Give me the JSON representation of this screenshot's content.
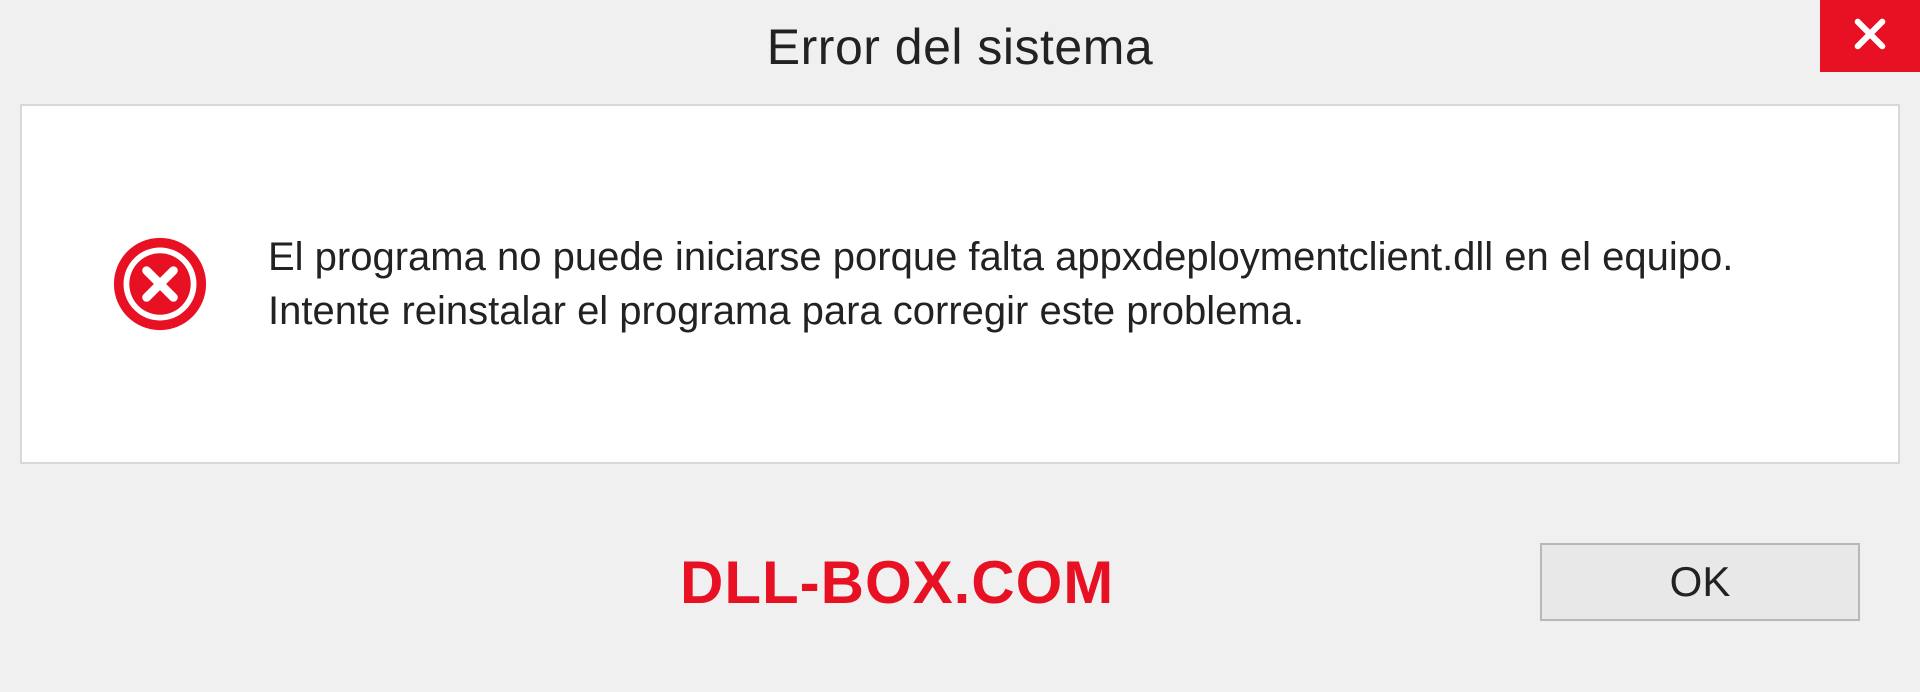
{
  "dialog": {
    "title": "Error del sistema",
    "message": "El programa no puede iniciarse porque falta appxdeploymentclient.dll en el equipo. Intente reinstalar el programa para corregir este problema.",
    "ok_label": "OK"
  },
  "watermark": "DLL-BOX.COM",
  "colors": {
    "error_red": "#e81123",
    "bg": "#f0f0f0",
    "panel_bg": "#ffffff",
    "border": "#d8d8d8"
  }
}
